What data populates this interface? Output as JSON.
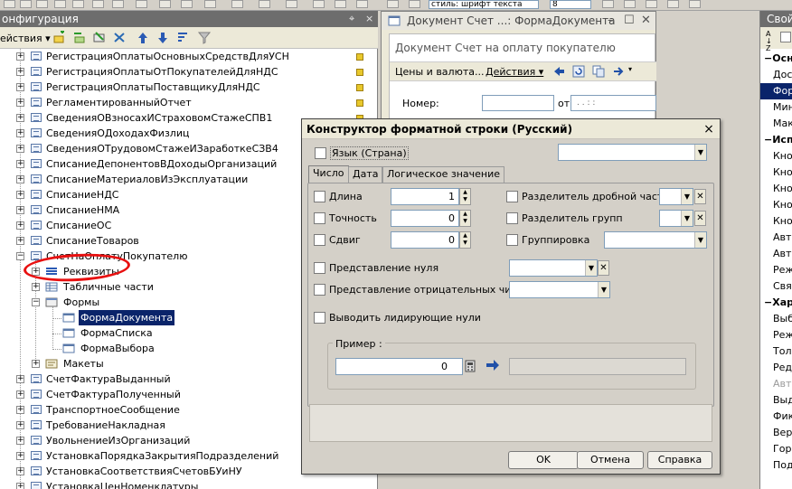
{
  "toolbar": {
    "style_combo": "стиль: шрифт текста",
    "size_combo": "8"
  },
  "config_panel": {
    "title": "онфигурация",
    "actions_label": "ействия",
    "pin_glyph": "⌖",
    "close_glyph": "×"
  },
  "tree": {
    "items": [
      {
        "label": "РегистрацияОплатыОсновныхСредствДляУСН"
      },
      {
        "label": "РегистрацияОплатыОтПокупателейДляНДС"
      },
      {
        "label": "РегистрацияОплатыПоставщикуДляНДС"
      },
      {
        "label": "РегламентированныйОтчет"
      },
      {
        "label": "СведенияОВзносахИСтраховомСтажеСПВ1"
      },
      {
        "label": "СведенияОДоходахФизлиц"
      },
      {
        "label": "СведенияОТрудовомСтажеИЗаработкеСЗВ4"
      },
      {
        "label": "СписаниеДепонентовВДоходыОрганизаций"
      },
      {
        "label": "СписаниеМатериаловИзЭксплуатации"
      },
      {
        "label": "СписаниеНДС"
      },
      {
        "label": "СписаниеНМА"
      },
      {
        "label": "СписаниеОС"
      },
      {
        "label": "СписаниеТоваров"
      },
      {
        "label": "СчетНаОплатуПокупателю"
      }
    ],
    "doc_children": {
      "rekvizity": "Реквизиты",
      "tabular": "Табличные части",
      "forms": "Формы",
      "form_doc": "ФормаДокумента",
      "form_list": "ФормаСписка",
      "form_choice": "ФормаВыбора",
      "layouts": "Макеты"
    },
    "items_after": [
      {
        "label": "СчетФактураВыданный"
      },
      {
        "label": "СчетФактураПолученный"
      },
      {
        "label": "ТранспортноеСообщение"
      },
      {
        "label": "ТребованиеНакладная"
      },
      {
        "label": "УвольнениеИзОрганизаций"
      },
      {
        "label": "УстановкаПорядкаЗакрытияПодразделений"
      },
      {
        "label": "УстановкаСоответствияСчетовБУиНУ"
      },
      {
        "label": "УстановкаЦенНоменклатуры"
      }
    ]
  },
  "doc_window": {
    "title": "Документ Счет ...: ФормаДокумента",
    "header": "Документ Счет на оплату покупателю",
    "prices_link": "Цены и валюта...",
    "actions_link": "Действия",
    "number_label": "Номер:",
    "from_label": "от:",
    "date_placeholder": ". .   :  :"
  },
  "props_panel": {
    "title": "Свойс",
    "sort_glyph": "A↓Z",
    "rows": [
      {
        "label": "Осно",
        "kind": "group"
      },
      {
        "label": "Дос",
        "kind": "item"
      },
      {
        "label": "Форм",
        "kind": "selected"
      },
      {
        "label": "Мин",
        "kind": "item"
      },
      {
        "label": "Мак",
        "kind": "item"
      },
      {
        "label": "Исп",
        "kind": "group"
      },
      {
        "label": "Кноп",
        "kind": "item"
      },
      {
        "label": "Кноп",
        "kind": "item"
      },
      {
        "label": "Кноп",
        "kind": "item"
      },
      {
        "label": "Кноп",
        "kind": "item"
      },
      {
        "label": "Кноп",
        "kind": "item"
      },
      {
        "label": "Авто",
        "kind": "item"
      },
      {
        "label": "Авто",
        "kind": "item"
      },
      {
        "label": "Реж",
        "kind": "item"
      },
      {
        "label": "Связ",
        "kind": "item"
      },
      {
        "label": "Хар",
        "kind": "group"
      },
      {
        "label": "Выб",
        "kind": "item"
      },
      {
        "label": "Реж",
        "kind": "item"
      },
      {
        "label": "Толь",
        "kind": "item"
      },
      {
        "label": "Реда",
        "kind": "item"
      },
      {
        "label": "Авто",
        "kind": "gray"
      },
      {
        "label": "Выд",
        "kind": "item"
      },
      {
        "label": "Фик",
        "kind": "item"
      },
      {
        "label": "Верт",
        "kind": "item"
      },
      {
        "label": "Гори",
        "kind": "item"
      },
      {
        "label": "Под",
        "kind": "item"
      }
    ]
  },
  "dialog": {
    "title": "Конструктор форматной строки (Русский)",
    "close_glyph": "×",
    "language_label": "Язык (Страна)",
    "tabs": [
      {
        "label": "Число"
      },
      {
        "label": "Дата"
      },
      {
        "label": "Логическое значение"
      }
    ],
    "length_label": "Длина",
    "length_value": "1",
    "precision_label": "Точность",
    "precision_value": "0",
    "shift_label": "Сдвиг",
    "shift_value": "0",
    "frac_sep_label": "Разделитель дробной части",
    "group_sep_label": "Разделитель групп",
    "grouping_label": "Группировка",
    "null_repr_label": "Представление нуля",
    "neg_repr_label": "Представление отрицательных чисел",
    "leading_zeros_label": "Выводить лидирующие нули",
    "example_label": "Пример :",
    "example_value": "0",
    "ok": "OK",
    "cancel": "Отмена",
    "help": "Справка"
  },
  "colors": {
    "selection": "#0a246a",
    "annotation": "#e81010",
    "arrow": "#2050a8"
  }
}
